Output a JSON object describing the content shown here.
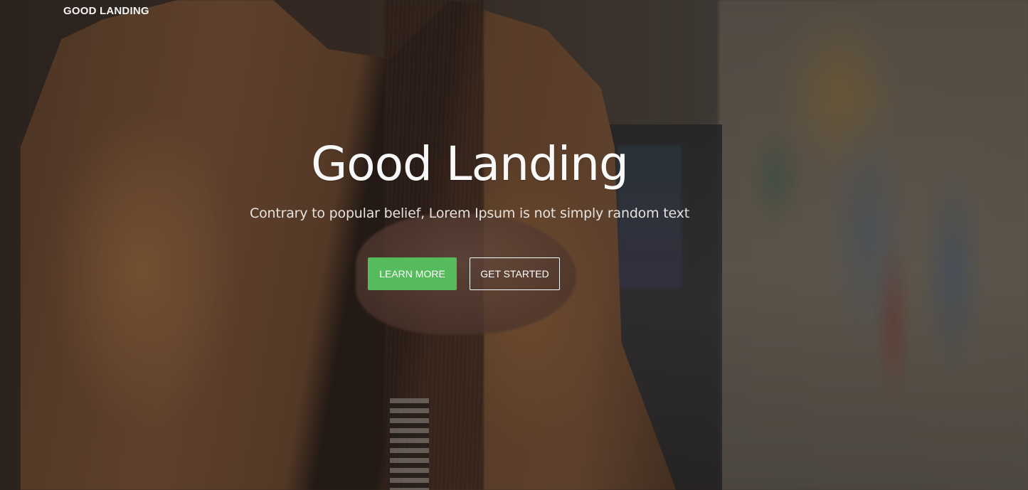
{
  "navbar": {
    "brand": "GOOD LANDING"
  },
  "hero": {
    "title": "Good Landing",
    "subtitle": "Contrary to popular belief, Lorem Ipsum is not simply random text",
    "buttons": {
      "learn_more": "LEARN MORE",
      "get_started": "GET STARTED"
    },
    "colors": {
      "primary_button": "#56bb5d",
      "text": "#ffffff"
    },
    "background_image": "woman-in-leather-jacket-photo"
  }
}
